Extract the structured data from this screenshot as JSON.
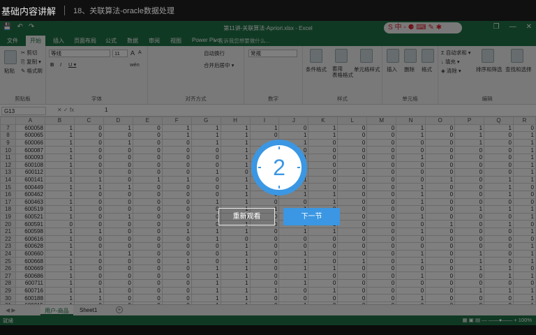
{
  "video": {
    "course_title": "基础内容讲解",
    "lesson_title": "18、关联算法-oracle数据处理",
    "countdown": "2",
    "replay_label": "重新观看",
    "next_label": "下一节"
  },
  "excel": {
    "doc_title": "第11讲-关联算法-Apriori.xlsx - Excel",
    "qat": {
      "save": "💾",
      "undo": "↶",
      "redo": "↷"
    },
    "sogou": "S 中 ◦ ⚈ ⌨ ✎ ✱",
    "win": {
      "restore": "❐",
      "min": "—",
      "close": "✕"
    },
    "tabs": [
      "文件",
      "开始",
      "插入",
      "页面布局",
      "公式",
      "数据",
      "审阅",
      "视图",
      "Power Pivot"
    ],
    "active_tab": "开始",
    "tell_me": "♀ 告诉我您想要做什么...",
    "ribbon": {
      "clipboard": {
        "paste": "粘贴",
        "cut": "✂ 剪切",
        "copy": "⎘ 复制 ▾",
        "format_painter": "✎ 格式刷",
        "group": "剪贴板"
      },
      "font": {
        "name": "等线",
        "size": "11",
        "grow": "A",
        "shrink": "A",
        "bold": "B",
        "italic": "I",
        "underline": "U ▾",
        "wen": "wén",
        "group": "字体"
      },
      "align": {
        "wrap": "自动换行",
        "merge": "合并后居中 ▾",
        "group": "对齐方式"
      },
      "number": {
        "format": "常规",
        "group": "数字"
      },
      "styles": {
        "conditional": "条件格式",
        "table": "套用\n表格格式",
        "cell": "单元格样式",
        "group": "样式"
      },
      "cells": {
        "insert": "插入",
        "delete": "删除",
        "format": "格式",
        "group": "单元格"
      },
      "editing": {
        "autosum": "Σ 自动求和 ▾",
        "fill": "↓ 填充 ▾",
        "clear": "◈ 清除 ▾",
        "sort": "排序和筛选",
        "find": "查找和选择",
        "group": "编辑"
      }
    },
    "name_box": "G13",
    "fx": "✕  ✓  fx",
    "formula_value": "1",
    "columns": [
      "",
      "A",
      "B",
      "C",
      "D",
      "E",
      "F",
      "G",
      "H",
      "I",
      "J",
      "K",
      "L",
      "M",
      "N",
      "O",
      "P",
      "Q",
      "R"
    ],
    "rows": [
      {
        "n": "7",
        "id": "600058",
        "v": [
          "1",
          "0",
          "1",
          "0",
          "1",
          "1",
          "1",
          "1",
          "0",
          "1",
          "0",
          "0",
          "1",
          "0",
          "1",
          "1",
          "0"
        ]
      },
      {
        "n": "8",
        "id": "600065",
        "v": [
          "1",
          "0",
          "0",
          "0",
          "1",
          "1",
          "1",
          "0",
          "1",
          "1",
          "0",
          "0",
          "1",
          "0",
          "1",
          "0",
          "1"
        ]
      },
      {
        "n": "9",
        "id": "600066",
        "v": [
          "1",
          "0",
          "1",
          "0",
          "0",
          "1",
          "1",
          "0",
          "1",
          "0",
          "0",
          "0",
          "0",
          "0",
          "1",
          "0",
          "1"
        ]
      },
      {
        "n": "10",
        "id": "600087",
        "v": [
          "1",
          "0",
          "0",
          "0",
          "0",
          "0",
          "1",
          "0",
          "0",
          "0",
          "0",
          "0",
          "0",
          "0",
          "0",
          "0",
          "1"
        ]
      },
      {
        "n": "11",
        "id": "600093",
        "v": [
          "1",
          "0",
          "0",
          "0",
          "0",
          "0",
          "1",
          "0",
          "1",
          "0",
          "0",
          "0",
          "1",
          "0",
          "0",
          "0",
          "1"
        ]
      },
      {
        "n": "12",
        "id": "600108",
        "v": [
          "1",
          "0",
          "0",
          "0",
          "0",
          "0",
          "1",
          "0",
          "1",
          "0",
          "0",
          "0",
          "0",
          "0",
          "0",
          "0",
          "1"
        ]
      },
      {
        "n": "13",
        "id": "600112",
        "v": [
          "1",
          "0",
          "0",
          "0",
          "0",
          "1",
          "0",
          "0",
          "1",
          "0",
          "1",
          "0",
          "0",
          "0",
          "0",
          "0",
          "1"
        ]
      },
      {
        "n": "14",
        "id": "600141",
        "v": [
          "1",
          "1",
          "0",
          "1",
          "1",
          "0",
          "1",
          "0",
          "1",
          "0",
          "0",
          "0",
          "0",
          "1",
          "0",
          "1",
          "1"
        ]
      },
      {
        "n": "15",
        "id": "600449",
        "v": [
          "1",
          "1",
          "1",
          "0",
          "0",
          "0",
          "1",
          "0",
          "1",
          "0",
          "0",
          "0",
          "1",
          "0",
          "0",
          "1",
          "0"
        ]
      },
      {
        "n": "16",
        "id": "600462",
        "v": [
          "1",
          "0",
          "0",
          "0",
          "0",
          "0",
          "1",
          "0",
          "1",
          "1",
          "0",
          "0",
          "1",
          "0",
          "0",
          "1",
          "0"
        ]
      },
      {
        "n": "17",
        "id": "600463",
        "v": [
          "1",
          "0",
          "0",
          "0",
          "0",
          "1",
          "1",
          "0",
          "0",
          "1",
          "0",
          "0",
          "1",
          "0",
          "0",
          "0",
          "0"
        ]
      },
      {
        "n": "18",
        "id": "600519",
        "v": [
          "1",
          "0",
          "0",
          "0",
          "0",
          "0",
          "1",
          "1",
          "1",
          "0",
          "0",
          "0",
          "0",
          "0",
          "1",
          "1",
          "1"
        ]
      },
      {
        "n": "19",
        "id": "600521",
        "v": [
          "1",
          "0",
          "1",
          "0",
          "0",
          "0",
          "1",
          "0",
          "1",
          "0",
          "0",
          "0",
          "1",
          "0",
          "0",
          "0",
          "1"
        ]
      },
      {
        "n": "20",
        "id": "600591",
        "v": [
          "0",
          "0",
          "0",
          "0",
          "0",
          "0",
          "1",
          "0",
          "0",
          "1",
          "0",
          "0",
          "0",
          "1",
          "0",
          "1",
          "0"
        ]
      },
      {
        "n": "21",
        "id": "600598",
        "v": [
          "1",
          "1",
          "0",
          "0",
          "1",
          "1",
          "1",
          "0",
          "1",
          "1",
          "0",
          "0",
          "1",
          "0",
          "0",
          "0",
          "1"
        ]
      },
      {
        "n": "22",
        "id": "600616",
        "v": [
          "1",
          "0",
          "0",
          "0",
          "0",
          "1",
          "0",
          "0",
          "0",
          "0",
          "0",
          "0",
          "0",
          "0",
          "0",
          "0",
          "0"
        ]
      },
      {
        "n": "23",
        "id": "600628",
        "v": [
          "1",
          "0",
          "0",
          "0",
          "0",
          "0",
          "1",
          "0",
          "0",
          "0",
          "0",
          "0",
          "0",
          "0",
          "0",
          "0",
          "1"
        ]
      },
      {
        "n": "24",
        "id": "600660",
        "v": [
          "1",
          "1",
          "1",
          "0",
          "0",
          "0",
          "1",
          "0",
          "1",
          "0",
          "0",
          "0",
          "1",
          "0",
          "1",
          "0",
          "1"
        ]
      },
      {
        "n": "25",
        "id": "600668",
        "v": [
          "1",
          "0",
          "0",
          "0",
          "1",
          "0",
          "1",
          "0",
          "1",
          "0",
          "1",
          "0",
          "1",
          "0",
          "1",
          "0",
          "1"
        ]
      },
      {
        "n": "26",
        "id": "600669",
        "v": [
          "1",
          "0",
          "0",
          "0",
          "0",
          "1",
          "1",
          "0",
          "1",
          "1",
          "0",
          "0",
          "0",
          "0",
          "1",
          "1",
          "0"
        ]
      },
      {
        "n": "27",
        "id": "600686",
        "v": [
          "1",
          "0",
          "0",
          "0",
          "0",
          "1",
          "1",
          "0",
          "1",
          "0",
          "0",
          "0",
          "1",
          "0",
          "0",
          "1",
          "1"
        ]
      },
      {
        "n": "28",
        "id": "600711",
        "v": [
          "1",
          "0",
          "0",
          "0",
          "0",
          "1",
          "1",
          "0",
          "1",
          "0",
          "0",
          "0",
          "0",
          "0",
          "0",
          "0",
          "0"
        ]
      },
      {
        "n": "29",
        "id": "600716",
        "v": [
          "1",
          "1",
          "0",
          "0",
          "0",
          "1",
          "1",
          "1",
          "0",
          "1",
          "0",
          "0",
          "0",
          "0",
          "1",
          "1",
          "1"
        ]
      },
      {
        "n": "30",
        "id": "600188",
        "v": [
          "1",
          "1",
          "0",
          "0",
          "0",
          "1",
          "1",
          "0",
          "0",
          "0",
          "0",
          "0",
          "1",
          "0",
          "0",
          "0",
          "1"
        ]
      },
      {
        "n": "31",
        "id": "600215",
        "v": [
          "1",
          "0",
          "0",
          "0",
          "0",
          "1",
          "1",
          "0",
          "1",
          "0",
          "0",
          "0",
          "0",
          "0",
          "0",
          "0",
          "1"
        ]
      }
    ],
    "sheet_tabs": [
      "用户-商品",
      "Sheet1"
    ],
    "sheet_nav": "◀ ▶",
    "add_sheet": "+",
    "status": {
      "ready": "就绪",
      "zoom": "▦ ▣ ▤  —  ——●——  +  100%"
    }
  }
}
